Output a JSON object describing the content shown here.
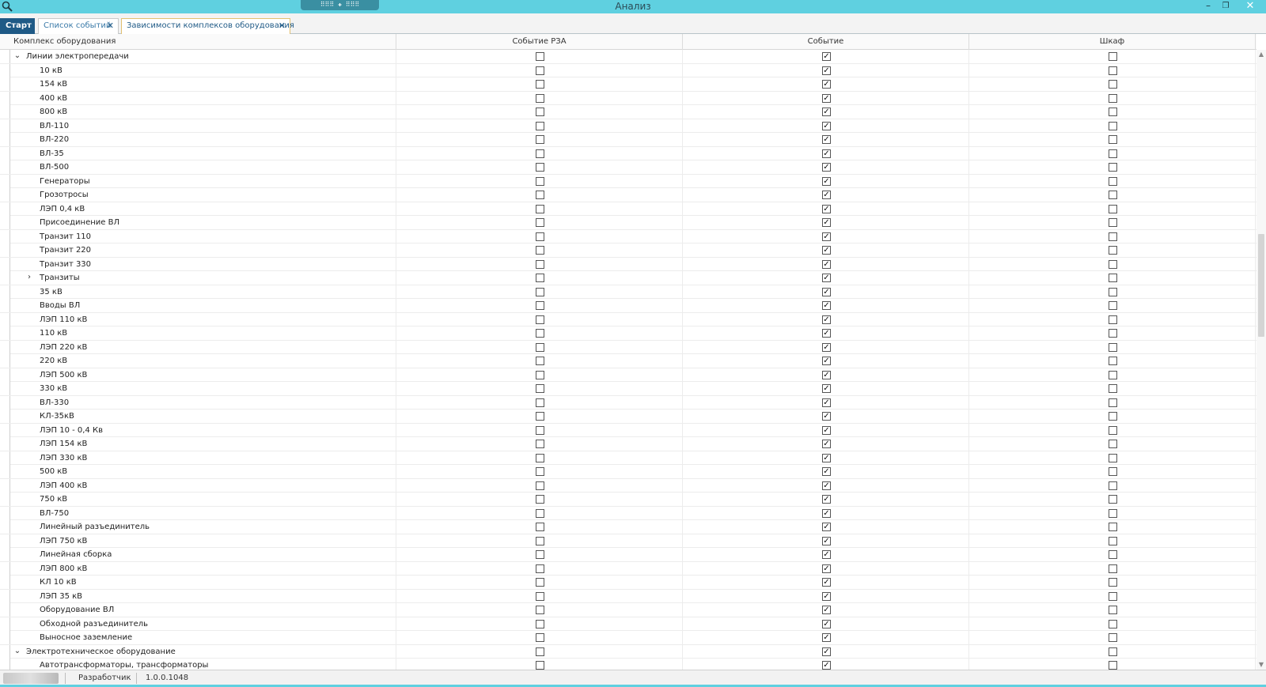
{
  "window": {
    "title": "Анализ",
    "grip_label": "⠿⠿⠿ ✚ ⠿⠿⠿",
    "min_label": "–",
    "restore_label": "❐",
    "close_label": "✕"
  },
  "tabs": [
    {
      "label": "Старт"
    },
    {
      "label": "Список событий",
      "close": "✕"
    },
    {
      "label": "Зависимости комплексов оборудования",
      "close": "✕"
    }
  ],
  "grid": {
    "columns": [
      "Комплекс оборудования",
      "Событие РЗА",
      "Событие",
      "Шкаф"
    ],
    "check_mark": "✓",
    "expanded_glyph": "⌄",
    "collapsed_glyph": "›",
    "rows": [
      {
        "name": "Линии электропередачи",
        "level": 0,
        "toggle": "expanded",
        "rza": false,
        "event": true,
        "cab": false
      },
      {
        "name": "10 кВ",
        "level": 1,
        "rza": false,
        "event": true,
        "cab": false
      },
      {
        "name": "154 кВ",
        "level": 1,
        "rza": false,
        "event": true,
        "cab": false
      },
      {
        "name": "400 кВ",
        "level": 1,
        "rza": false,
        "event": true,
        "cab": false
      },
      {
        "name": "800 кВ",
        "level": 1,
        "rza": false,
        "event": true,
        "cab": false
      },
      {
        "name": "ВЛ-110",
        "level": 1,
        "rza": false,
        "event": true,
        "cab": false
      },
      {
        "name": "ВЛ-220",
        "level": 1,
        "rza": false,
        "event": true,
        "cab": false
      },
      {
        "name": "ВЛ-35",
        "level": 1,
        "rza": false,
        "event": true,
        "cab": false
      },
      {
        "name": "ВЛ-500",
        "level": 1,
        "rza": false,
        "event": true,
        "cab": false
      },
      {
        "name": "Генераторы",
        "level": 1,
        "rza": false,
        "event": true,
        "cab": false
      },
      {
        "name": "Грозотросы",
        "level": 1,
        "rza": false,
        "event": true,
        "cab": false
      },
      {
        "name": "ЛЭП 0,4 кВ",
        "level": 1,
        "rza": false,
        "event": true,
        "cab": false
      },
      {
        "name": "Присоединение ВЛ",
        "level": 1,
        "rza": false,
        "event": true,
        "cab": false
      },
      {
        "name": "Транзит 110",
        "level": 1,
        "rza": false,
        "event": true,
        "cab": false
      },
      {
        "name": "Транзит 220",
        "level": 1,
        "rza": false,
        "event": true,
        "cab": false
      },
      {
        "name": "Транзит 330",
        "level": 1,
        "rza": false,
        "event": true,
        "cab": false
      },
      {
        "name": "Транзиты",
        "level": 1,
        "toggle": "collapsed",
        "rza": false,
        "event": true,
        "cab": false
      },
      {
        "name": "35 кВ",
        "level": 1,
        "rza": false,
        "event": true,
        "cab": false
      },
      {
        "name": "Вводы ВЛ",
        "level": 1,
        "rza": false,
        "event": true,
        "cab": false
      },
      {
        "name": "ЛЭП 110 кВ",
        "level": 1,
        "rza": false,
        "event": true,
        "cab": false
      },
      {
        "name": "110 кВ",
        "level": 1,
        "rza": false,
        "event": true,
        "cab": false
      },
      {
        "name": "ЛЭП 220 кВ",
        "level": 1,
        "rza": false,
        "event": true,
        "cab": false
      },
      {
        "name": "220 кВ",
        "level": 1,
        "rza": false,
        "event": true,
        "cab": false
      },
      {
        "name": "ЛЭП 500 кВ",
        "level": 1,
        "rza": false,
        "event": true,
        "cab": false
      },
      {
        "name": "330 кВ",
        "level": 1,
        "rza": false,
        "event": true,
        "cab": false
      },
      {
        "name": "ВЛ-330",
        "level": 1,
        "rza": false,
        "event": true,
        "cab": false
      },
      {
        "name": "КЛ-35кВ",
        "level": 1,
        "rza": false,
        "event": true,
        "cab": false
      },
      {
        "name": "ЛЭП 10 - 0,4 Кв",
        "level": 1,
        "rza": false,
        "event": true,
        "cab": false
      },
      {
        "name": "ЛЭП 154 кВ",
        "level": 1,
        "rza": false,
        "event": true,
        "cab": false
      },
      {
        "name": "ЛЭП 330 кВ",
        "level": 1,
        "rza": false,
        "event": true,
        "cab": false
      },
      {
        "name": "500 кВ",
        "level": 1,
        "rza": false,
        "event": true,
        "cab": false
      },
      {
        "name": "ЛЭП 400 кВ",
        "level": 1,
        "rza": false,
        "event": true,
        "cab": false
      },
      {
        "name": "750 кВ",
        "level": 1,
        "rza": false,
        "event": true,
        "cab": false
      },
      {
        "name": "ВЛ-750",
        "level": 1,
        "rza": false,
        "event": true,
        "cab": false
      },
      {
        "name": "Линейный разъединитель",
        "level": 1,
        "rza": false,
        "event": true,
        "cab": false
      },
      {
        "name": "ЛЭП 750 кВ",
        "level": 1,
        "rza": false,
        "event": true,
        "cab": false
      },
      {
        "name": "Линейная сборка",
        "level": 1,
        "rza": false,
        "event": true,
        "cab": false
      },
      {
        "name": "ЛЭП 800 кВ",
        "level": 1,
        "rza": false,
        "event": true,
        "cab": false
      },
      {
        "name": "КЛ 10 кВ",
        "level": 1,
        "rza": false,
        "event": true,
        "cab": false
      },
      {
        "name": "ЛЭП 35 кВ",
        "level": 1,
        "rza": false,
        "event": true,
        "cab": false
      },
      {
        "name": "Оборудование ВЛ",
        "level": 1,
        "rza": false,
        "event": true,
        "cab": false
      },
      {
        "name": "Обходной разъединитель",
        "level": 1,
        "rza": false,
        "event": true,
        "cab": false
      },
      {
        "name": "Выносное заземление",
        "level": 1,
        "rza": false,
        "event": true,
        "cab": false
      },
      {
        "name": "Электротехническое оборудование",
        "level": 0,
        "toggle": "expanded",
        "rza": false,
        "event": true,
        "cab": false
      },
      {
        "name": "Автотрансформаторы, трансформаторы",
        "level": 1,
        "rza": false,
        "event": true,
        "cab": false
      }
    ]
  },
  "scrollbar": {
    "up": "▲",
    "down": "▼"
  },
  "status": {
    "role": "Разработчик",
    "version": "1.0.0.1048"
  },
  "colors": {
    "titlebar": "#5fd0e0",
    "tab_active": "#1f5a86",
    "close_button": "#e81123"
  }
}
